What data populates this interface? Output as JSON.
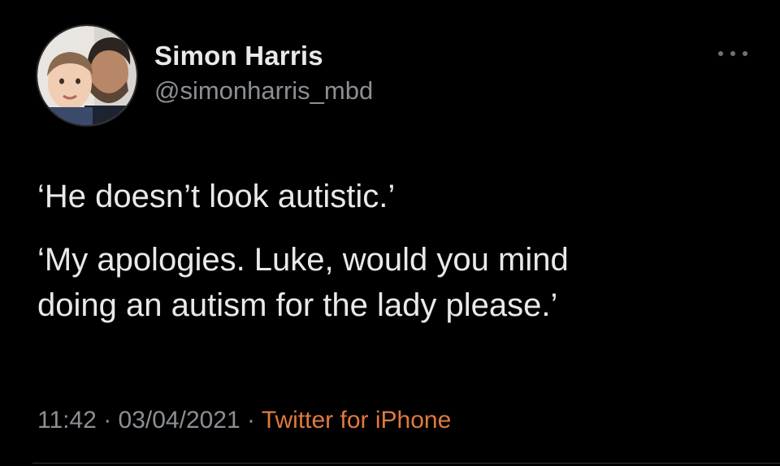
{
  "tweet": {
    "author": {
      "display_name": "Simon Harris",
      "handle": "@simonharris_mbd"
    },
    "more_icon": "ellipsis-icon",
    "text": {
      "line1": "‘He doesn’t look autistic.’",
      "line2a": "‘My apologies. Luke, would you mind",
      "line2b": "doing an autism for the lady please.’"
    },
    "meta": {
      "time": "11:42",
      "separator": "·",
      "date": "03/04/2021",
      "source": "Twitter for iPhone"
    }
  },
  "colors": {
    "background": "#000000",
    "primary_text": "#e7e9ea",
    "secondary_text": "#8b8f94",
    "source_link": "#e0793f"
  }
}
